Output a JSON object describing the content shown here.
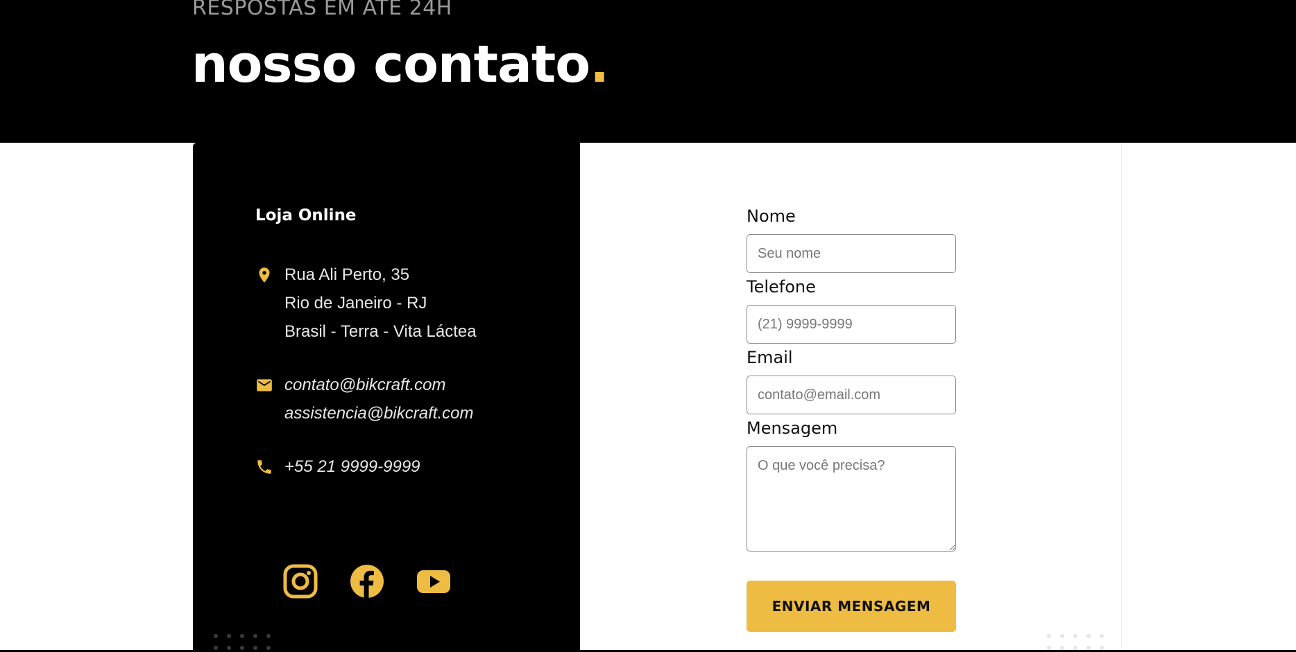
{
  "hero": {
    "subtitle": "RESPOSTAS EM ATÉ 24H",
    "title": "nosso contato",
    "title_dot": "."
  },
  "info": {
    "store_title": "Loja Online",
    "address": {
      "icon": "location-pin-icon",
      "lines": [
        "Rua Ali Perto, 35",
        "Rio de Janeiro - RJ",
        "Brasil - Terra - Vita Láctea"
      ]
    },
    "emails": {
      "icon": "mail-icon",
      "lines": [
        "contato@bikcraft.com",
        "assistencia@bikcraft.com"
      ]
    },
    "phone": {
      "icon": "phone-icon",
      "lines": [
        "+55 21 9999-9999"
      ]
    },
    "socials": [
      {
        "name": "instagram-icon"
      },
      {
        "name": "facebook-icon"
      },
      {
        "name": "youtube-icon"
      }
    ]
  },
  "form": {
    "name_label": "Nome",
    "name_placeholder": "Seu nome",
    "phone_label": "Telefone",
    "phone_placeholder": "(21) 9999-9999",
    "email_label": "Email",
    "email_placeholder": "contato@email.com",
    "message_label": "Mensagem",
    "message_placeholder": "O que você precisa?",
    "submit_label": "ENVIAR MENSAGEM"
  },
  "colors": {
    "accent": "#eebc43",
    "hero_bg": "#000000",
    "panel_bg": "#000000"
  }
}
